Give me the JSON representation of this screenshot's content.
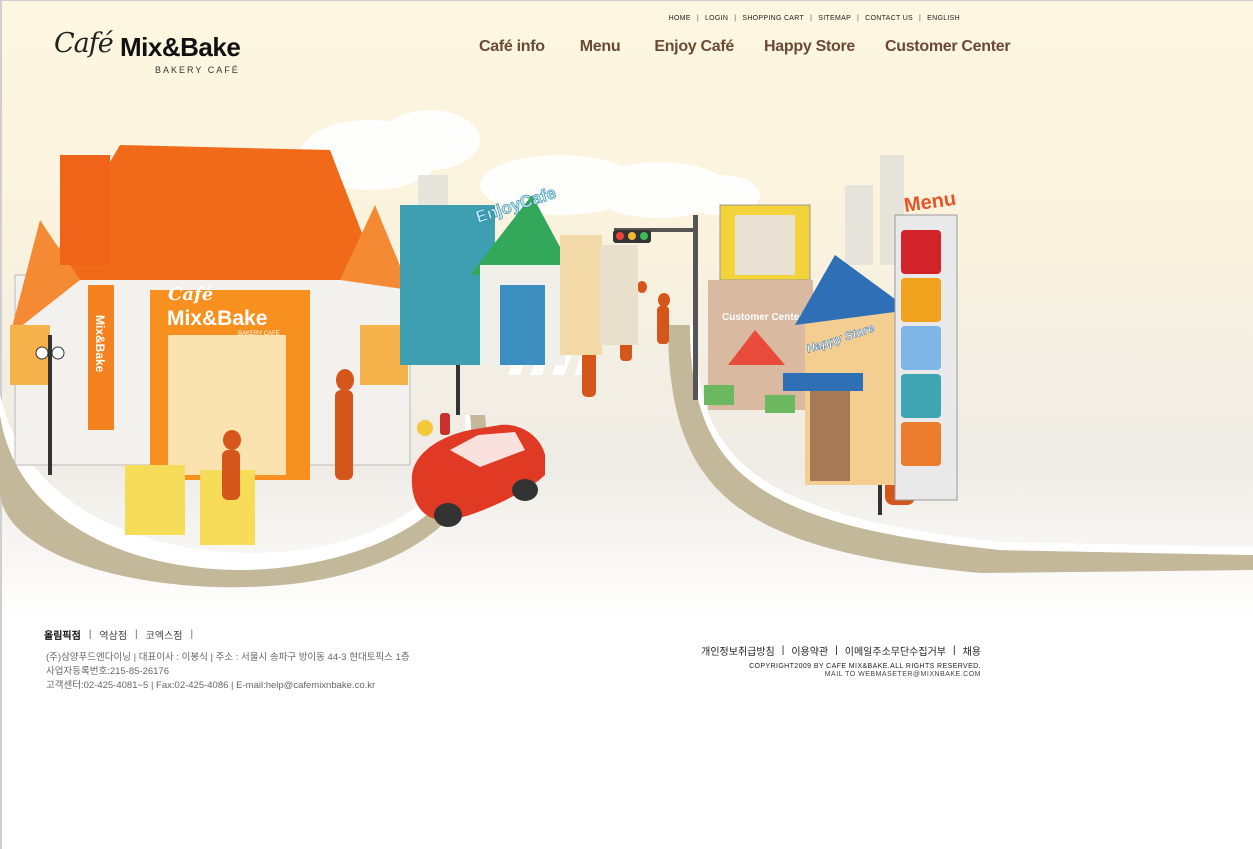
{
  "logo": {
    "script": "Café",
    "name": "Mix&Bake",
    "tagline": "BAKERY CAFÉ"
  },
  "util_nav": [
    "HOME",
    "LOGIN",
    "SHOPPING CART",
    "SITEMAP",
    "CONTACT US",
    "ENGLISH"
  ],
  "main_nav": [
    "Café info",
    "Menu",
    "Enjoy Café",
    "Happy Store",
    "Customer Center"
  ],
  "scene": {
    "cafe_sign_script": "Café",
    "cafe_sign_name": "Mix&Bake",
    "cafe_sign_sub": "BAKERY CAFE",
    "vertical_sign": "Mix&Bake",
    "enjoy_sign": "EnjoyCafe",
    "customer_center_sign": "Customer Center",
    "happy_store_sign": "Happy Store",
    "menu_sign": "Menu"
  },
  "footer": {
    "stores": [
      "올림픽점",
      "역삼점",
      "코엑스점"
    ],
    "company_line": "(주)삼양푸드엔다이닝 | 대표이사 : 이봉식 | 주소 : 서울시 송파구 방이동 44-3 현대토픽스 1층",
    "biz_line": "사업자등록번호:215-85-26176",
    "contact_line": "고객센터:02-425-4081~5 | Fax:02-425-4086 | E-mail:help@cafemixnbake.co.kr",
    "policies": [
      "개인정보취급방침",
      "이용약관",
      "이메일주소무단수집거부",
      "채용"
    ],
    "copyright": "COPYRIGHT2009 BY CAFE MIX&BAKE.ALL RIGHTS RESERVED.",
    "mailto": "MAIL TO WEBMASETER@MIXNBAKE.COM"
  },
  "colors": {
    "nav_brown": "#6b4a35",
    "orange": "#f06a1a",
    "teal": "#3f9fb2"
  }
}
